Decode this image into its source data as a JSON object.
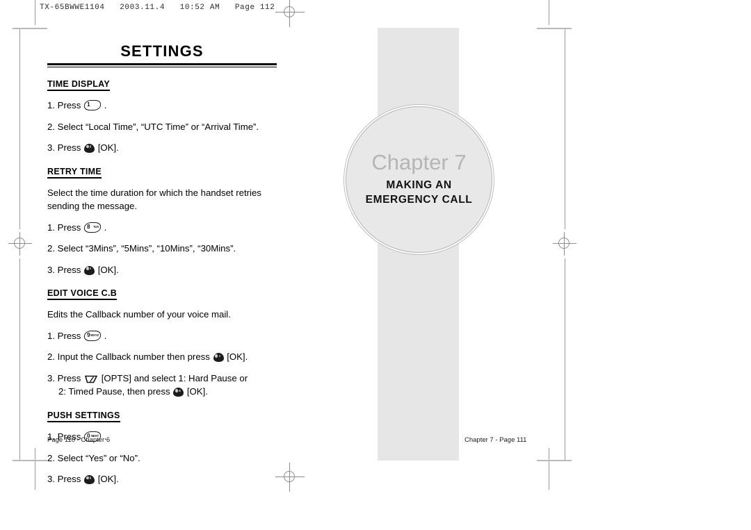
{
  "plate": {
    "header": "TX-65BWWE1104   2003.11.4   10:52 AM   Page 112"
  },
  "left_page": {
    "title": "SETTINGS",
    "footer": "Page 110 - Chapter 6",
    "sections": [
      {
        "heading": "TIME DISPLAY",
        "steps": [
          {
            "prefix": "1. Press",
            "key": "key-voicemail-icon",
            "key_digit": "1",
            "key_sub": "",
            "suffix": "."
          },
          {
            "prefix": "2. Select “Local Time”, “UTC Time” or “Arrival Time”.",
            "key": "",
            "suffix": ""
          },
          {
            "prefix": "3. Press",
            "key": "key-ok-icon",
            "suffix": "[OK]."
          }
        ]
      },
      {
        "heading": "RETRY TIME",
        "intro": "Select the time duration for which the handset retries sending the message.",
        "steps": [
          {
            "prefix": "1. Press",
            "key": "key-8-icon",
            "key_digit": "8",
            "key_sub": "TUV",
            "suffix": "."
          },
          {
            "prefix": "2. Select “3Mins”, “5Mins”, “10Mins”, “30Mins”.",
            "key": "",
            "suffix": ""
          },
          {
            "prefix": "3. Press",
            "key": "key-ok-icon",
            "suffix": "[OK]."
          }
        ]
      },
      {
        "heading": "EDIT VOICE C.B",
        "intro": "Edits the Callback number of your voice mail.",
        "steps": [
          {
            "prefix": "1. Press",
            "key": "key-9-icon",
            "key_digit": "9",
            "key_sub": "WXYZ",
            "suffix": "."
          },
          {
            "prefix": "2. Input the Callback number then press",
            "key": "key-ok-icon",
            "suffix": "[OK]."
          },
          {
            "prefix": "3. Press",
            "key": "key-opts-icon",
            "suffix": "[OPTS] and select 1: Hard Pause or",
            "continuation_prefix": "2: Timed Pause, then press",
            "continuation_key": "key-ok-icon",
            "continuation_suffix": "[OK]."
          }
        ]
      },
      {
        "heading": "PUSH SETTINGS",
        "steps": [
          {
            "prefix": "1. Press",
            "key": "key-0-icon",
            "key_digit": "0",
            "key_sub": "NEXT",
            "suffix": "."
          },
          {
            "prefix": "2. Select “Yes” or “No”.",
            "key": "",
            "suffix": ""
          },
          {
            "prefix": "3. Press",
            "key": "key-ok-icon",
            "suffix": "[OK]."
          }
        ]
      }
    ]
  },
  "right_page": {
    "chapter_label": "Chapter 7",
    "chapter_title_line1": "MAKING AN",
    "chapter_title_line2": "EMERGENCY CALL",
    "footer": "Chapter 7 - Page 111"
  },
  "colors": {
    "band_gray": "#e6e6e6",
    "circle_gray": "#e8e8e8",
    "chapter_word_gray": "#b5b5b5",
    "mark_gray": "#8c8c8c"
  }
}
